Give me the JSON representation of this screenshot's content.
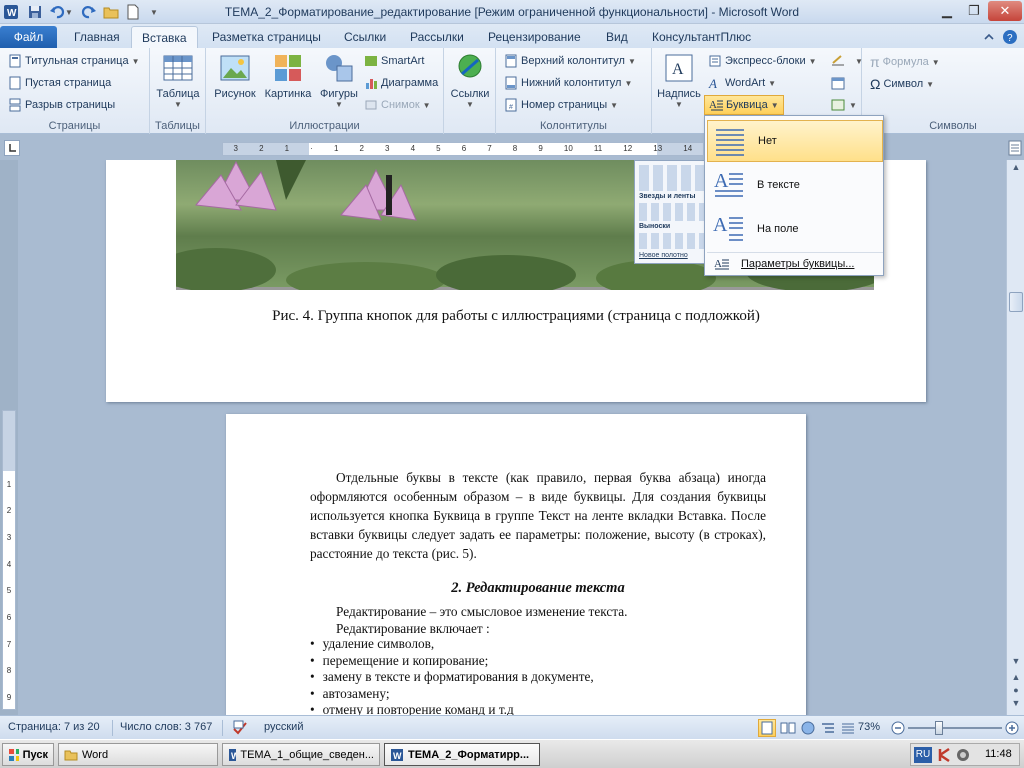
{
  "window": {
    "title": "ТЕМА_2_Форматирование_редактирование [Режим ограниченной функциональности]  -  Microsoft Word"
  },
  "tabs": [
    {
      "label": "Файл"
    },
    {
      "label": "Главная"
    },
    {
      "label": "Вставка"
    },
    {
      "label": "Разметка страницы"
    },
    {
      "label": "Ссылки"
    },
    {
      "label": "Рассылки"
    },
    {
      "label": "Рецензирование"
    },
    {
      "label": "Вид"
    },
    {
      "label": "КонсультантПлюс"
    }
  ],
  "ribbon": {
    "pages": {
      "title_page": "Титульная страница",
      "blank_page": "Пустая страница",
      "page_break": "Разрыв страницы",
      "label": "Страницы"
    },
    "tables": {
      "table": "Таблица",
      "label": "Таблицы"
    },
    "illustrations": {
      "picture": "Рисунок",
      "clipart": "Картинка",
      "shapes": "Фигуры",
      "smartart": "SmartArt",
      "chart": "Диаграмма",
      "screenshot": "Снимок",
      "label": "Иллюстрации"
    },
    "links": {
      "links": "Ссылки"
    },
    "headerfooter": {
      "header": "Верхний колонтитул",
      "footer": "Нижний колонтитул",
      "page_number": "Номер страницы",
      "label": "Колонтитулы"
    },
    "text": {
      "textbox": "Надпись",
      "quickparts": "Экспресс-блоки",
      "wordart": "WordArt",
      "dropcap": "Буквица"
    },
    "symbols": {
      "formula": "Формула",
      "symbol": "Символ",
      "label": "Символы"
    }
  },
  "dropcap_menu": {
    "none": "Нет",
    "dropped": "В тексте",
    "in_margin": "На поле",
    "options": "Параметры буквицы..."
  },
  "document": {
    "caption": "Рис. 4. Группа кнопок для работы с иллюстрациями (страница с подложкой)",
    "para1": "Отдельные буквы в тексте (как правило, первая буква абзаца) иногда оформляются особенным образом – в виде буквицы. Для создания буквицы используется кнопка Буквица в группе Текст на ленте вкладки Вставка. После вставки буквицы следует задать ее параметры: положение, высоту (в строках), расстояние до текста (рис. 5).",
    "heading": "2. Редактирование текста",
    "line1": "Редактирование – это смысловое изменение текста.",
    "line2": "Редактирование включает :",
    "bullets": [
      "удаление символов,",
      "перемещение и копирование;",
      "замену в тексте и форматирования в документе,",
      "автозамену;",
      "отмену и повторение команд и т.д"
    ],
    "gallery": {
      "stars": "Звезды и ленты",
      "callouts": "Выноски",
      "new_canvas": "Новое полотно"
    }
  },
  "ruler_numbers": [
    "3",
    "2",
    "1",
    "1",
    "2",
    "3",
    "4",
    "5",
    "6",
    "7",
    "8",
    "9",
    "10",
    "11",
    "12",
    "13",
    "14"
  ],
  "vruler_numbers": [
    "1",
    "1",
    "2",
    "3",
    "4",
    "5",
    "6",
    "7",
    "8",
    "9"
  ],
  "statusbar": {
    "page": "Страница: 7 из 20",
    "words": "Число слов: 3 767",
    "lang": "русский",
    "zoom": "73%"
  },
  "taskbar": {
    "start": "Пуск",
    "items": [
      "Word",
      "ТЕМА_1_общие_сведен...",
      "ТЕМА_2_Форматирр..."
    ],
    "lang": "RU",
    "time": "11:48"
  },
  "colors": {
    "accent": "#2b6ec1",
    "ribbon_bg": "#dfe8f4",
    "doc_bg": "#a9bbd1"
  }
}
